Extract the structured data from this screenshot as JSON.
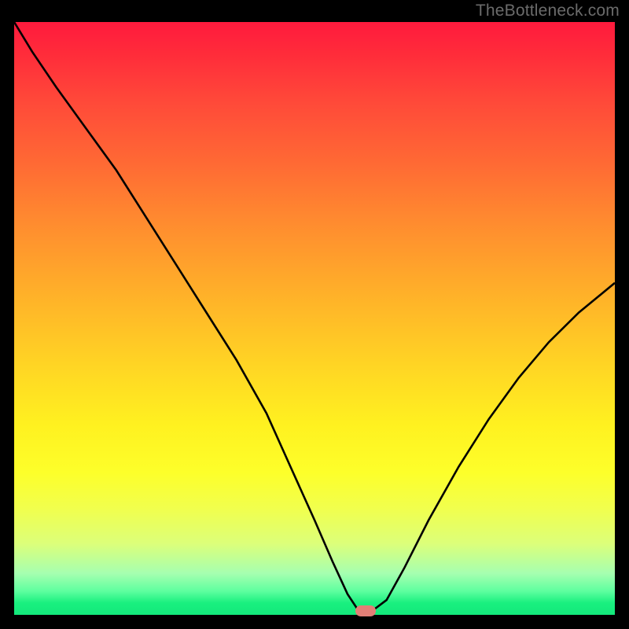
{
  "watermark": "TheBottleneck.com",
  "colors": {
    "curve_stroke": "#000000",
    "marker": "#e27e76",
    "background": "#000000"
  },
  "chart_data": {
    "type": "line",
    "title": "",
    "xlabel": "",
    "ylabel": "",
    "xlim": [
      0,
      100
    ],
    "ylim": [
      0,
      100
    ],
    "x": [
      0,
      3,
      7,
      12,
      17,
      22,
      27,
      32,
      37,
      42,
      46,
      50,
      53,
      55.5,
      57,
      58,
      59.5,
      62,
      65,
      69,
      74,
      79,
      84,
      89,
      94,
      100
    ],
    "values": [
      100,
      95,
      89,
      82,
      75,
      67,
      59,
      51,
      43,
      34,
      25,
      16,
      9,
      3.5,
      1.2,
      0.6,
      0.6,
      2.5,
      8,
      16,
      25,
      33,
      40,
      46,
      51,
      56
    ],
    "marker": {
      "x": 58.5,
      "y": 0.6
    },
    "gradient_stops": [
      {
        "pos": 0.0,
        "color": "#ff1a3d"
      },
      {
        "pos": 0.24,
        "color": "#ff6a34"
      },
      {
        "pos": 0.58,
        "color": "#ffd524"
      },
      {
        "pos": 0.82,
        "color": "#f1ff4d"
      },
      {
        "pos": 0.96,
        "color": "#5eff9f"
      },
      {
        "pos": 1.0,
        "color": "#13e87b"
      }
    ]
  }
}
